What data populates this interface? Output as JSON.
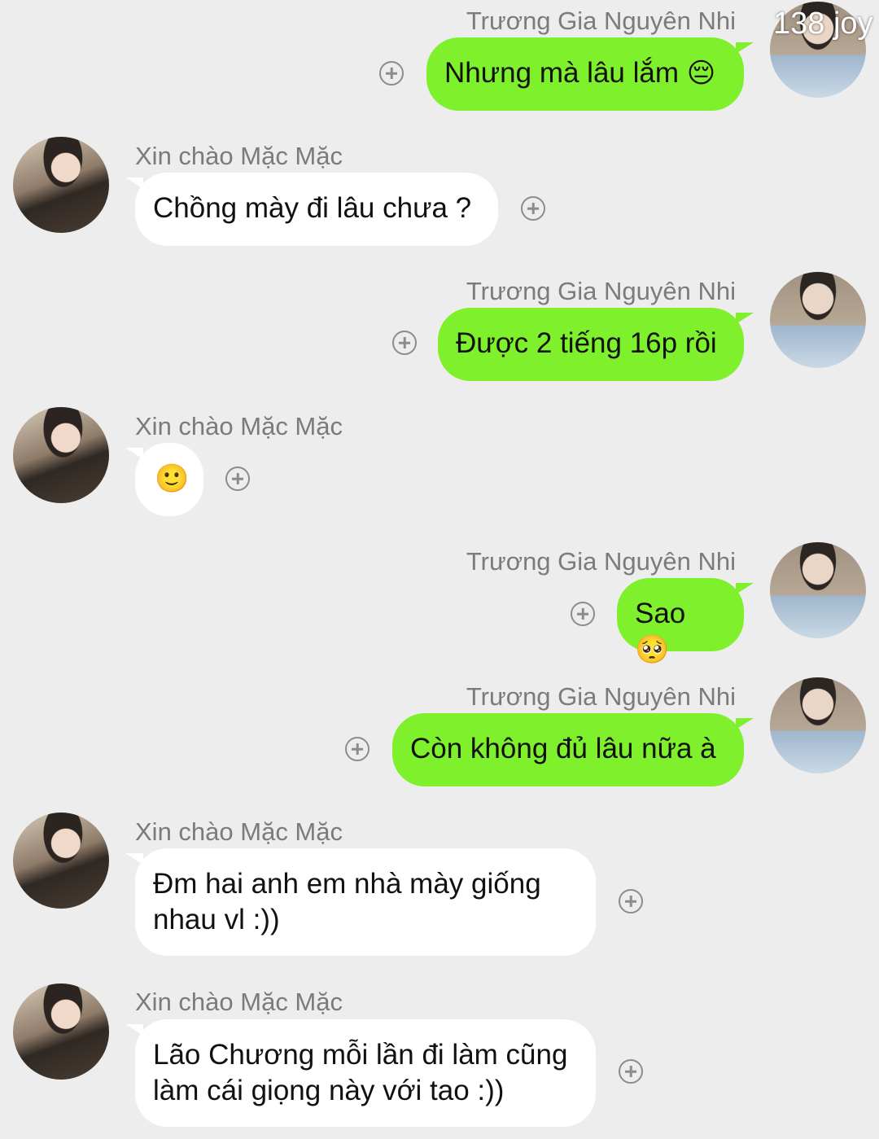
{
  "watermark": "138 joy",
  "messages": [
    {
      "side": "right",
      "sender": "Trương Gia Nguyên Nhi",
      "text": "Nhưng mà lâu lắm",
      "emoji": "😔"
    },
    {
      "side": "left",
      "sender": "Xin chào Mặc Mặc",
      "text": "Chồng mày đi lâu chưa ?"
    },
    {
      "side": "right",
      "sender": "Trương Gia Nguyên Nhi",
      "text": "Được 2 tiếng 16p rồi"
    },
    {
      "side": "left",
      "sender": "Xin chào Mặc Mặc",
      "text": "",
      "emoji": "🙂"
    },
    {
      "side": "right",
      "sender": "Trương Gia Nguyên Nhi",
      "text": "Sao",
      "emoji": "🥺"
    },
    {
      "side": "right",
      "sender": "Trương Gia Nguyên Nhi",
      "text": "Còn không đủ lâu nữa à"
    },
    {
      "side": "left",
      "sender": "Xin chào Mặc Mặc",
      "text": "Đm hai anh em nhà mày giống nhau vl :))"
    },
    {
      "side": "left",
      "sender": "Xin chào Mặc Mặc",
      "text": "Lão Chương mỗi lần đi làm cũng làm cái giọng này với tao :))"
    }
  ],
  "icons": {
    "add": "plus-circle-icon",
    "avatar_me": "user-avatar-icon",
    "avatar_friend": "friend-avatar-icon"
  },
  "colors": {
    "outgoing_bubble": "#7ef02c",
    "incoming_bubble": "#ffffff",
    "background": "#ededed",
    "sender_name": "#7b7b7b"
  }
}
